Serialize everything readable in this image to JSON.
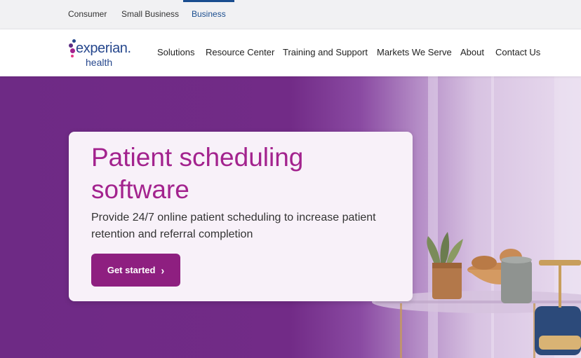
{
  "audience_tabs": [
    {
      "label": "Consumer"
    },
    {
      "label": "Small Business"
    },
    {
      "label": "Business",
      "active": true
    }
  ],
  "brand": {
    "name": "experian.",
    "sub": "health",
    "logo_color": "#26478d",
    "dot_colors": [
      "#a3238e",
      "#26478d",
      "#5b2c83",
      "#e63888"
    ]
  },
  "nav": {
    "items": [
      {
        "label": "Solutions"
      },
      {
        "label": "Resource Center"
      },
      {
        "label": "Training and Support"
      },
      {
        "label": "Markets We Serve"
      },
      {
        "label": "About"
      },
      {
        "label": "Contact Us"
      }
    ]
  },
  "hero": {
    "title": "Patient scheduling software",
    "subtitle": "Provide 24/7 online patient scheduling to increase patient retention and referral completion",
    "cta_label": "Get started",
    "cta_icon": "chevron-right-icon",
    "accent_color": "#a3238e",
    "background_color": "#722b87"
  }
}
